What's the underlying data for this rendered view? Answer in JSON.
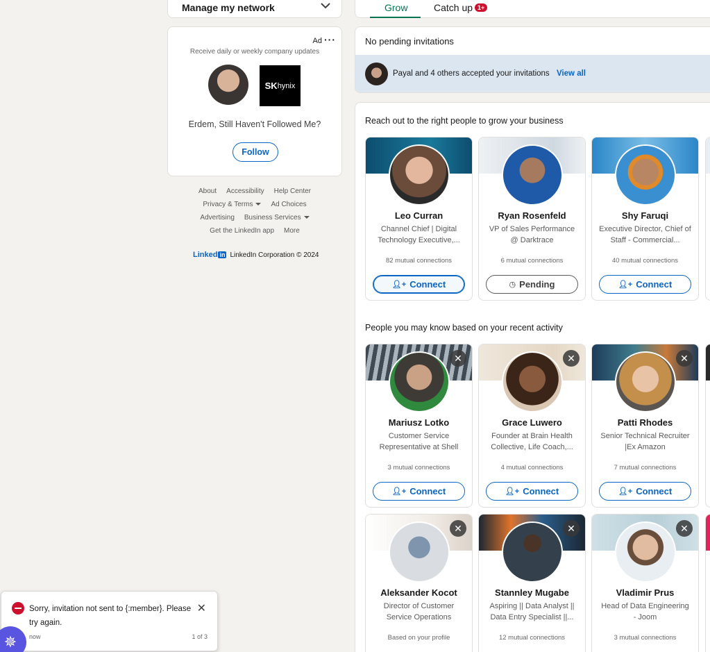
{
  "left": {
    "manage_network": "Manage my network",
    "ad": {
      "label": "Ad",
      "subtitle": "Receive daily or weekly company updates",
      "logo_bold": "SK",
      "logo_light": "hynix",
      "headline": "Erdem, Still Haven't Followed Me?",
      "follow_label": "Follow"
    },
    "footer": {
      "about": "About",
      "accessibility": "Accessibility",
      "help_center": "Help Center",
      "privacy_terms": "Privacy & Terms",
      "ad_choices": "Ad Choices",
      "advertising": "Advertising",
      "business_services": "Business Services",
      "get_app": "Get the LinkedIn app",
      "more": "More",
      "brand_word": "Linked",
      "brand_box": "in",
      "copyright": "LinkedIn Corporation © 2024"
    }
  },
  "tabs": {
    "grow": "Grow",
    "catch_up": "Catch up",
    "catch_up_badge": "1+"
  },
  "invites": {
    "none_pending": "No pending invitations",
    "accepted_text": "Payal and 4 others accepted your invitations",
    "view_all": "View all"
  },
  "sections": {
    "grow_business": "Reach out to the right people to grow your business",
    "recent_activity": "People you may know based on your recent activity"
  },
  "people_business": [
    {
      "name": "Leo Curran",
      "headline": "Channel Chief | Digital Technology Executive,...",
      "mutual": "82 mutual connections",
      "action": "Connect",
      "state": "connect-focused"
    },
    {
      "name": "Ryan Rosenfeld",
      "headline": "VP of Sales Performance @ Darktrace",
      "mutual": "6 mutual connections",
      "action": "Pending",
      "state": "pending"
    },
    {
      "name": "Shy Faruqi",
      "headline": "Executive Director, Chief of Staff - Commercial...",
      "mutual": "40 mutual connections",
      "action": "Connect",
      "state": "connect"
    }
  ],
  "people_recent": [
    {
      "name": "Mariusz Lotko",
      "headline": "Customer Service Representative at Shell",
      "mutual": "3 mutual connections",
      "action": "Connect"
    },
    {
      "name": "Grace Luwero",
      "headline": "Founder at Brain Health Collective, Life Coach,...",
      "mutual": "4 mutual connections",
      "action": "Connect"
    },
    {
      "name": "Patti Rhodes",
      "headline": "Senior Technical Recruiter |Ex Amazon",
      "mutual": "7 mutual connections",
      "action": "Connect"
    }
  ],
  "people_more": [
    {
      "name": "Aleksander Kocot",
      "headline": "Director of Customer Service Operations",
      "mutual": "Based on your profile"
    },
    {
      "name": "Stannley Mugabe",
      "headline": "Aspiring || Data Analyst || Data Entry Specialist ||...",
      "mutual": "12 mutual connections"
    },
    {
      "name": "Vladimir Prus",
      "headline": "Head of Data Engineering - Joom",
      "mutual": "3 mutual connections"
    }
  ],
  "dismiss_glyph": "✕",
  "toast": {
    "message": "Sorry, invitation not sent to {:member}. Please try again.",
    "time": "now",
    "count": "1 of 3",
    "close_glyph": "✕"
  },
  "colors": {
    "brand_blue": "#0a66c2",
    "grow_green": "#01754f",
    "error_red": "#cb112d",
    "accepted_bg": "#dce6f1"
  }
}
